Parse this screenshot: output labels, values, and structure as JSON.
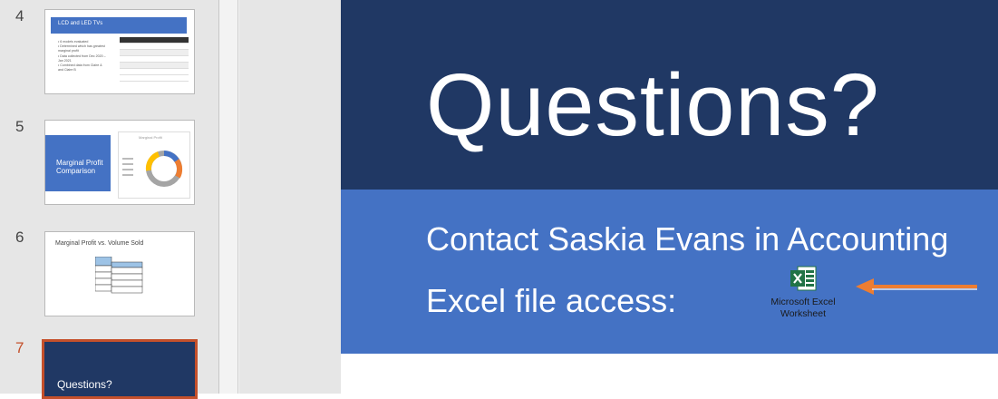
{
  "thumbnails": [
    {
      "number": "4",
      "title": "LCD and LED TVs",
      "bullets": [
        "• 6 models evaluated",
        "• Determined which has greatest marginal profit",
        "• Data collected from Dec 2020 – Jan 2021",
        "• Combined data from Claire & and Claire B"
      ]
    },
    {
      "number": "5",
      "title": "Marginal Profit Comparison",
      "chart_title": "Marginal Profit"
    },
    {
      "number": "6",
      "title": "Marginal Profit vs. Volume Sold"
    },
    {
      "number": "7",
      "title": "Questions?"
    }
  ],
  "slide": {
    "title": "Questions?",
    "contact": "Contact Saskia Evans in Accounting",
    "access": "Excel file access:",
    "embed_label": "Microsoft Excel\nWorksheet",
    "embed_icon": "excel-icon"
  },
  "colors": {
    "dark_blue": "#203864",
    "mid_blue": "#4472c4",
    "active_accent": "#c4502b",
    "arrow": "#ed7d31",
    "excel_green": "#217346"
  }
}
